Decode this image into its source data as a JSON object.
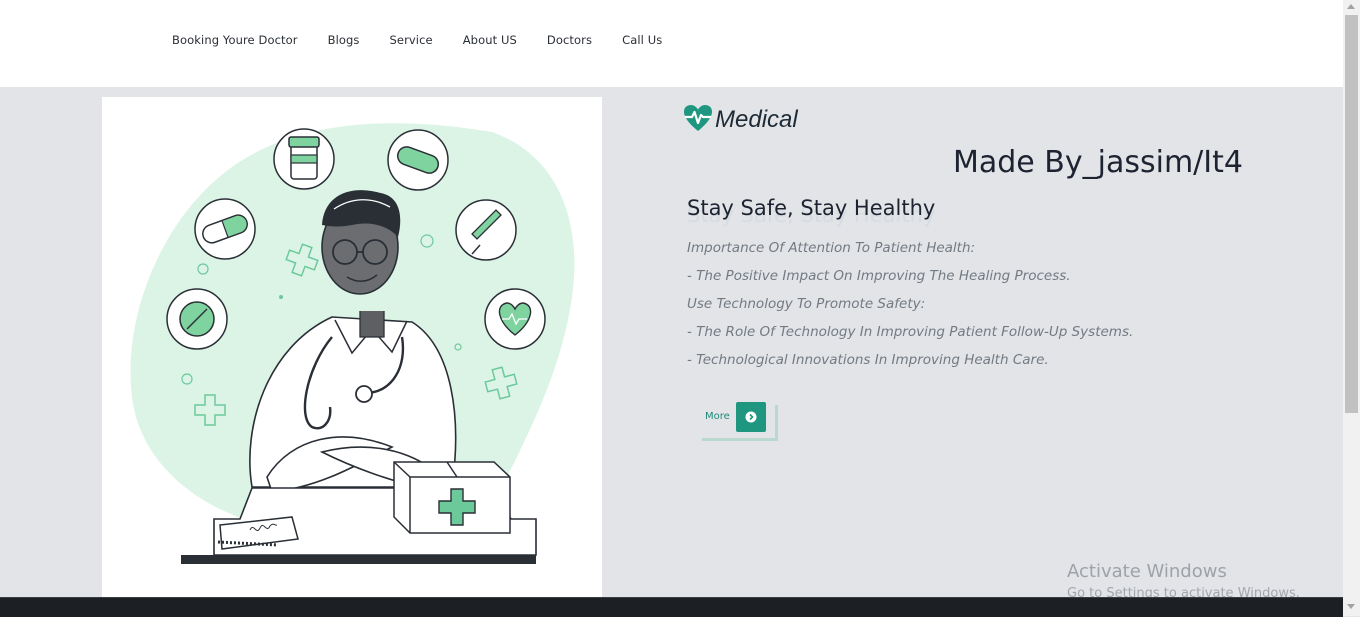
{
  "nav": {
    "links": [
      "Booking Youre Doctor",
      "Blogs",
      "Service",
      "About US",
      "Doctors",
      "Call Us"
    ]
  },
  "brand": {
    "name": "Medical",
    "icon": "heart-pulse-icon",
    "color": "#1f9780"
  },
  "hero": {
    "made_by": "Made By_jassim/It4",
    "headline": "Stay Safe, Stay Healthy",
    "lines": [
      "Importance Of Attention To Patient Health:",
      "- The Positive Impact On Improving The Healing Process.",
      "Use Technology To Promote Safety:",
      "- The Role Of Technology In Improving Patient Follow-Up Systems.",
      "- Technological Innovations In Improving Health Care."
    ],
    "more_label": "More",
    "more_icon": "arrow-right-circle-icon",
    "illustration": "doctor-illustration"
  },
  "watermark": {
    "title": "Activate Windows",
    "subtitle": "Go to Settings to activate Windows."
  },
  "colors": {
    "accent": "#1f9780",
    "background": "#e2e4e8",
    "footer": "#1c1f23"
  }
}
